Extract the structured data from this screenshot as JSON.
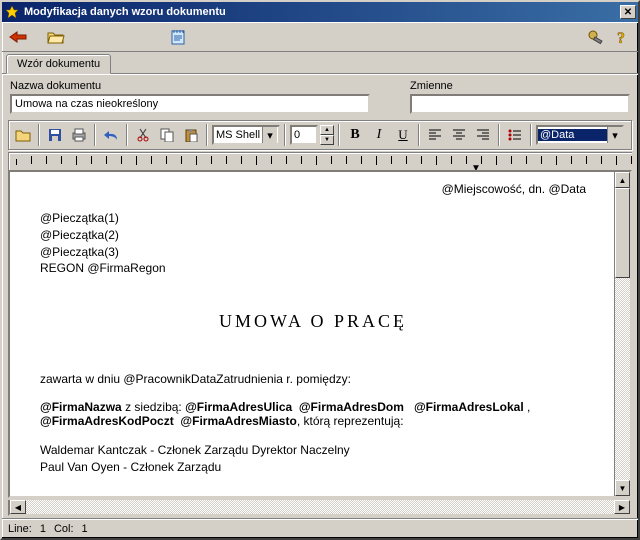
{
  "window": {
    "title": "Modyfikacja danych wzoru dokumentu"
  },
  "tab": {
    "label": "Wzór dokumentu"
  },
  "fields": {
    "name_label": "Nazwa dokumentu",
    "name_value": "Umowa na czas nieokreślony",
    "vars_label": "Zmienne",
    "vars_value": ""
  },
  "editor_toolbar": {
    "font_name": "MS Shell",
    "font_size": "0",
    "variable_field": "@Data"
  },
  "document": {
    "top_right": "@Miejscowość, dn. @Data",
    "stamp1": "@Pieczątka(1)",
    "stamp2": "@Pieczątka(2)",
    "stamp3": "@Pieczątka(3)",
    "regon": "REGON @FirmaRegon",
    "title": "UMOWA  O  PRACĘ",
    "intro": "zawarta w dniu @PracownikDataZatrudnienia r. pomiędzy:",
    "company": "@FirmaNazwa",
    "address_prefix": " z siedzibą:  ",
    "addr_ulica": "@FirmaAdresUlica",
    "addr_dom": "@FirmaAdresDom",
    "addr_lokal": "@FirmaAdresLokal",
    "addr_sep": " ,  ",
    "addr_kod": "@FirmaAdresKodPoczt",
    "addr_miasto": "@FirmaAdresMiasto",
    "repr": ", którą reprezentują:",
    "sig1": "Waldemar Kantczak - Członek Zarządu Dyrektor Naczelny",
    "sig2": "Paul Van Oyen - Członek Zarządu"
  },
  "status": {
    "line_label": "Line:",
    "line": "1",
    "col_label": "Col:",
    "col": "1"
  }
}
